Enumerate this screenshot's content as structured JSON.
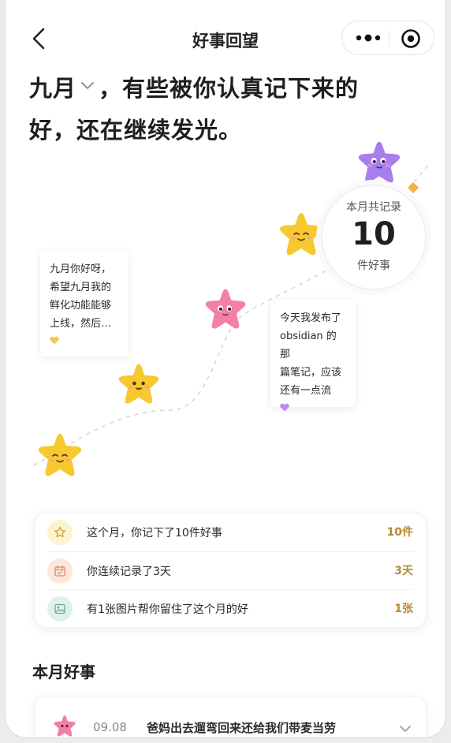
{
  "nav": {
    "title": "好事回望",
    "back_icon": "chevron-left-icon",
    "more_icon": "more-dots-icon",
    "close_icon": "target-icon"
  },
  "headline": {
    "month": "九月",
    "line1_rest": "，有些被你认真记下来的",
    "line2": "好，还在继续发光。"
  },
  "counter": {
    "top": "本月共记录",
    "number": "10",
    "bottom": "件好事"
  },
  "notes": [
    {
      "lines": [
        "九月你好呀，",
        "希望九月我的",
        "鲜化功能能够",
        "上线，然后…"
      ],
      "heart_color": "#f2c94c"
    },
    {
      "lines": [
        "今天我发布了",
        "obsidian 的那",
        "篇笔记，应该",
        "还有一点流"
      ],
      "heart_color": "#b58cf0"
    }
  ],
  "stats": [
    {
      "label": "这个月，你记下了10件好事",
      "value": "10件",
      "icon": "star-outline-icon",
      "icon_bg": "#fdf3cf",
      "icon_color": "#c8a040"
    },
    {
      "label": "你连续记录了3天",
      "value": "3天",
      "icon": "calendar-icon",
      "icon_bg": "#fde6dc",
      "icon_color": "#d98a6a"
    },
    {
      "label": "有1张图片帮你留住了这个月的好",
      "value": "1张",
      "icon": "image-icon",
      "icon_bg": "#dff2ea",
      "icon_color": "#6aa88c"
    }
  ],
  "section": {
    "title": "本月好事"
  },
  "list": [
    {
      "date": "09.08",
      "text": "爸妈出去遛弯回来还给我们带麦当劳",
      "star_color": "#f27fa6"
    }
  ],
  "colors": {
    "star_yellow": "#f7c82f",
    "star_pink": "#f47ea4",
    "star_purple": "#a77ef0",
    "accent_value": "#b4892f"
  }
}
